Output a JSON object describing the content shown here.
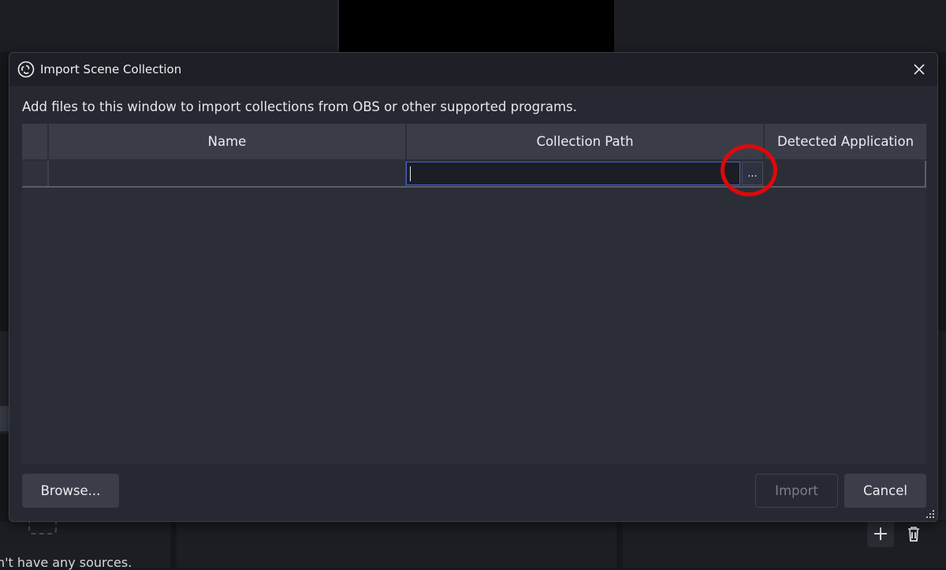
{
  "background": {
    "sources_empty_text": "n't have any sources."
  },
  "dialog": {
    "title": "Import Scene Collection",
    "app_icon": "obs-logo-icon",
    "close_icon": "close-icon",
    "instructions": "Add files to this window to import collections from OBS or other supported programs.",
    "table": {
      "columns": [
        "Name",
        "Collection Path",
        "Detected Application"
      ],
      "rows": [
        {
          "name": "",
          "path": "",
          "application": ""
        }
      ],
      "path_browse_label": "..."
    },
    "buttons": {
      "browse": "Browse...",
      "import": "Import",
      "cancel": "Cancel"
    },
    "annotation_color": "#e0080a",
    "accent_color": "#4a63c9"
  }
}
